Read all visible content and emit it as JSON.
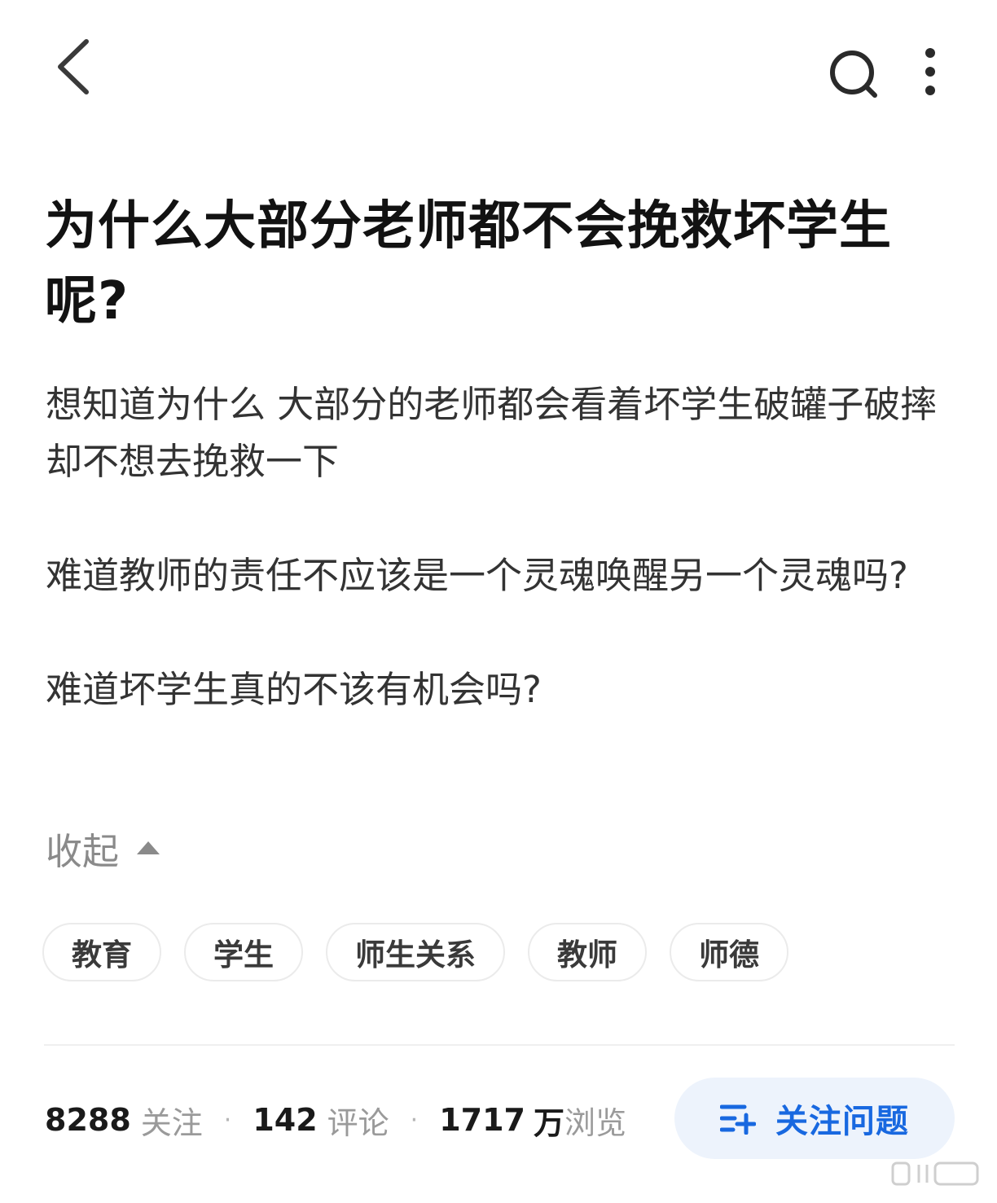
{
  "question": {
    "title": "为什么大部分老师都不会挽救坏学生呢?",
    "paragraphs": [
      "想知道为什么 大部分的老师都会看着坏学生破罐子破摔 却不想去挽救一下",
      "难道教师的责任不应该是一个灵魂唤醒另一个灵魂吗?",
      "难道坏学生真的不该有机会吗?"
    ],
    "collapse_label": "收起"
  },
  "tags": [
    "教育",
    "学生",
    "师生关系",
    "教师",
    "师德"
  ],
  "stats": {
    "followers": "8288",
    "followers_label": "关注",
    "comments": "142",
    "comments_label": "评论",
    "views": "1717",
    "views_unit": "万",
    "views_label": "浏览",
    "separator": "·"
  },
  "follow_button": {
    "label": "关注问题"
  },
  "icons": {
    "back": "chevron-left-icon",
    "search": "search-icon",
    "more": "more-vertical-icon",
    "follow": "follow-list-icon",
    "gesture": "gesture-bar-icon"
  },
  "colors": {
    "accent": "#1868e0",
    "follow_bg": "#edf3fc",
    "muted": "#8a8a8a"
  }
}
